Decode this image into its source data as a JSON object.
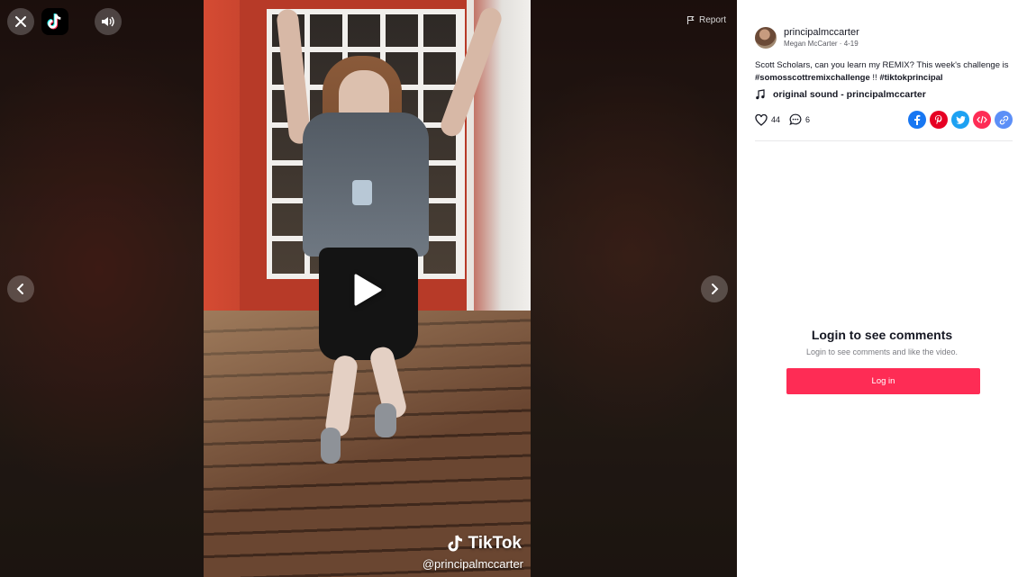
{
  "controls": {
    "report_label": "Report"
  },
  "video": {
    "watermark_brand": "TikTok",
    "watermark_user": "@principalmccarter"
  },
  "author": {
    "username": "principalmccarter",
    "display_name": "Megan McCarter",
    "separator": " · ",
    "date": "4-19"
  },
  "caption": {
    "text": "Scott Scholars, can you learn my REMIX? This week's challenge is",
    "hashtags": [
      "#somosscottremixchallenge",
      "!!",
      "#tiktokprincipal"
    ]
  },
  "sound": {
    "title": "original sound - principalmccarter"
  },
  "stats": {
    "likes": "44",
    "comments": "6"
  },
  "share_icons": [
    "facebook-icon",
    "pinterest-icon",
    "twitter-icon",
    "embed-icon",
    "link-icon"
  ],
  "colors": {
    "accent": "#fe2c55",
    "facebook": "#1877f2",
    "pinterest": "#e60023",
    "twitter": "#1da1f2",
    "embed": "#fe2c55",
    "link": "#5c8ff7"
  },
  "comments_section": {
    "title": "Login to see comments",
    "subtitle": "Login to see comments and like the video.",
    "button_label": "Log in"
  }
}
